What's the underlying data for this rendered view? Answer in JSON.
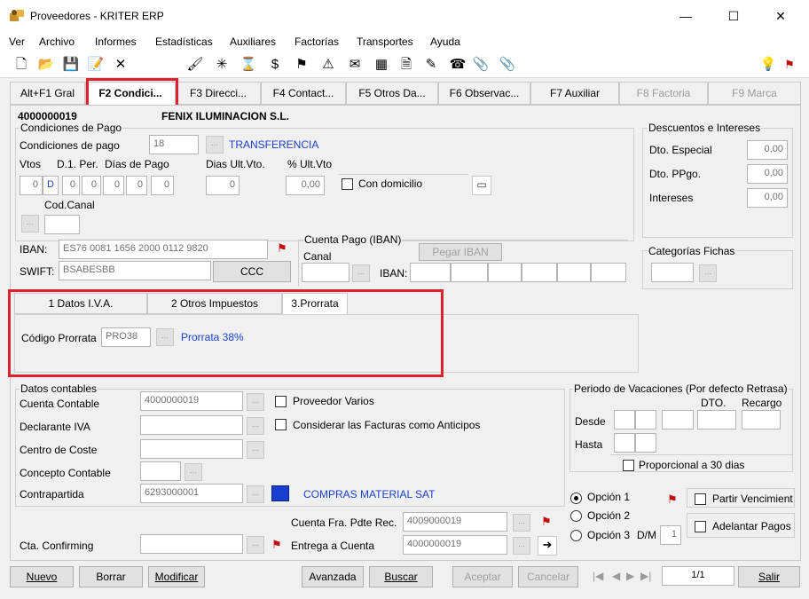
{
  "window": {
    "title": "Proveedores - KRITER ERP",
    "minimize": "—",
    "maximize": "☐",
    "close": "✕"
  },
  "menu": [
    "Ver",
    "Archivo",
    "Informes",
    "Estadísticas",
    "Auxiliares",
    "Factorías",
    "Transportes",
    "Ayuda"
  ],
  "tabs": [
    {
      "label": "Alt+F1 Gral"
    },
    {
      "label": "F2 Condici..."
    },
    {
      "label": "F3 Direcci..."
    },
    {
      "label": "F4 Contact..."
    },
    {
      "label": "F5 Otros Da..."
    },
    {
      "label": "F6 Observac..."
    },
    {
      "label": "F7 Auxiliar"
    },
    {
      "label": "F8 Factoria"
    },
    {
      "label": "F9 Marca"
    }
  ],
  "supplier": {
    "code": "4000000019",
    "name": "FENIX ILUMINACION S.L."
  },
  "cond_pago": {
    "group": "Condiciones de Pago",
    "label": "Condiciones de pago",
    "code": "18",
    "desc": "TRANSFERENCIA",
    "col_vtos": "Vtos",
    "col_d1": "D.1. Per.",
    "col_dias": "Días de Pago",
    "col_dias_ult": "Dias Ult.Vto.",
    "col_pct_ult": "% Ult.Vto",
    "vtos": "0",
    "d1": "D",
    "dias": [
      "0",
      "0",
      "0",
      "0",
      "0"
    ],
    "dias_ult": "0",
    "pct_ult": "0,00",
    "con_domicilio": "Con domicilio",
    "cod_canal": "Cod.Canal",
    "iban_label": "IBAN:",
    "iban": "ES76 0081 1656 2000 0112 9820",
    "swift_label": "SWIFT:",
    "swift": "BSABESBB",
    "ccc": "CCC",
    "cuenta_pago_group": "Cuenta Pago (IBAN)",
    "pegar_iban": "Pegar IBAN",
    "canal": "Canal",
    "iban2_label": "IBAN:"
  },
  "descuentos": {
    "group": "Descuentos e Intereses",
    "dto_especial": "Dto. Especial",
    "dto_especial_val": "0,00",
    "dto_ppgo": "Dto. PPgo.",
    "dto_ppgo_val": "0,00",
    "intereses": "Intereses",
    "intereses_val": "0,00"
  },
  "categorias": {
    "group": "Categorías Fichas"
  },
  "subtabs": {
    "t1": "1 Datos I.V.A.",
    "t2": "2 Otros Impuestos",
    "t3": "3.Prorrata",
    "codigo_prorrata": "Código Prorrata",
    "prorrata_code": "PRO38",
    "prorrata_desc": "Prorrata 38%"
  },
  "contables": {
    "group": "Datos contables",
    "cuenta_contable": "Cuenta Contable",
    "cuenta_contable_val": "4000000019",
    "proveedor_varios": "Proveedor Varios",
    "declarante_iva": "Declarante IVA",
    "considerar": "Considerar las Facturas como Anticipos",
    "centro_coste": "Centro de Coste",
    "concepto_contable": "Concepto Contable",
    "contrapartida": "Contrapartida",
    "contrapartida_val": "6293000001",
    "contrapartida_desc": "COMPRAS MATERIAL SAT",
    "cuenta_fra": "Cuenta Fra. Pdte Rec.",
    "cuenta_fra_val": "4009000019",
    "cta_confirming": "Cta. Confirming",
    "entrega_cuenta": "Entrega a Cuenta",
    "entrega_cuenta_val": "4000000019"
  },
  "vacaciones": {
    "group": "Periodo de Vacaciones (Por defecto Retrasa)",
    "dto": "DTO.",
    "recargo": "Recargo",
    "desde": "Desde",
    "hasta": "Hasta",
    "proporcional": "Proporcional a 30 dias",
    "opcion1": "Opción 1",
    "opcion2": "Opción 2",
    "opcion3": "Opción 3",
    "dm": "D/M",
    "dm_val": "1",
    "partir": "Partir Vencimient",
    "adelantar": "Adelantar Pagos"
  },
  "bottom": {
    "nuevo": "Nuevo",
    "borrar": "Borrar",
    "modificar": "Modificar",
    "avanzada": "Avanzada",
    "buscar": "Buscar",
    "aceptar": "Aceptar",
    "cancelar": "Cancelar",
    "nav_first": "|◀",
    "nav_prev": "◀",
    "nav_next": "▶",
    "nav_last": "▶|",
    "page": "1/1",
    "salir": "Salir"
  },
  "colors": {
    "highlight": "#e0202a",
    "link_blue": "#1a3fd0"
  }
}
